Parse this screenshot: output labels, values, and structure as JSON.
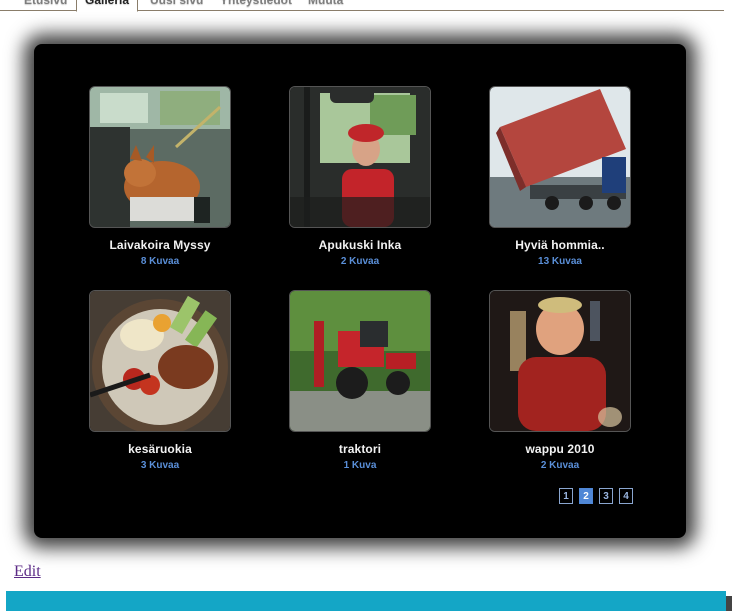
{
  "tabs": [
    {
      "label": "Etusivu",
      "active": false
    },
    {
      "label": "Galleria",
      "active": true
    },
    {
      "label": "Uusi sivu",
      "active": false
    },
    {
      "label": "Yhteystiedot",
      "active": false
    },
    {
      "label": "Muuta",
      "active": false
    }
  ],
  "albums": [
    {
      "title": "Laivakoira Myssy",
      "count": "8 Kuvaa"
    },
    {
      "title": "Apukuski Inka",
      "count": "2 Kuvaa"
    },
    {
      "title": "Hyviä hommia..",
      "count": "13 Kuvaa"
    },
    {
      "title": "kesäruokia",
      "count": "3 Kuvaa"
    },
    {
      "title": "traktori",
      "count": "1 Kuva"
    },
    {
      "title": "wappu 2010",
      "count": "2 Kuvaa"
    }
  ],
  "pagination": {
    "pages": [
      "1",
      "2",
      "3",
      "4"
    ],
    "current": "2"
  },
  "edit_label": "Edit",
  "colors": {
    "panel": "#000000",
    "count_text": "#5a8fd8",
    "footer_bar": "#14a6c6",
    "current_page": "#4f87d6"
  }
}
